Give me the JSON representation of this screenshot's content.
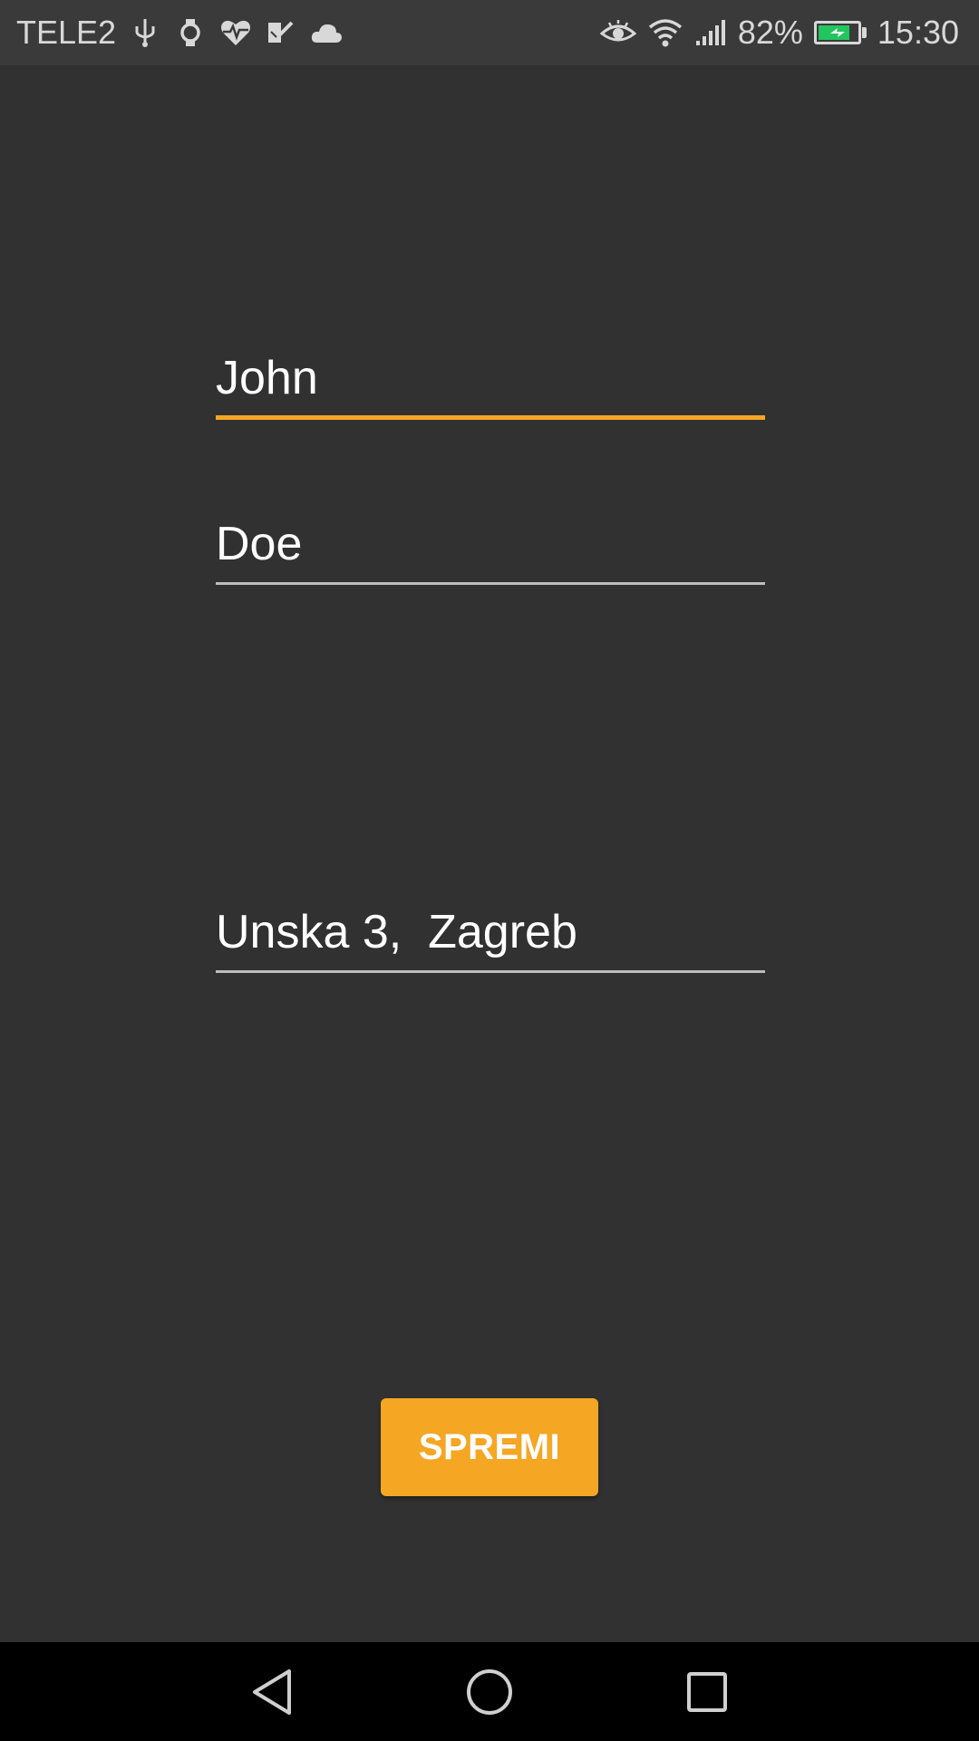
{
  "status_bar": {
    "carrier": "TELE2",
    "battery_percent": "82%",
    "battery_level": 0.82,
    "time": "15:30",
    "left_icons": [
      "usb-icon",
      "watch-icon",
      "heart-rate-icon",
      "tasks-icon",
      "cloud-icon"
    ],
    "right_icons": [
      "eye-icon",
      "wifi-icon",
      "signal-icon",
      "battery-charging-icon"
    ]
  },
  "form": {
    "first_name": "John",
    "last_name": "Doe",
    "address": "Unska 3,  Zagreb"
  },
  "save_button": {
    "label": "SPREMI"
  },
  "nav_bar": {
    "icons": [
      "back-icon",
      "home-icon",
      "recents-icon"
    ]
  },
  "colors": {
    "background": "#313131",
    "status_bar": "#3a3a3a",
    "accent": "#f5a623",
    "battery_fill": "#22c55e"
  }
}
